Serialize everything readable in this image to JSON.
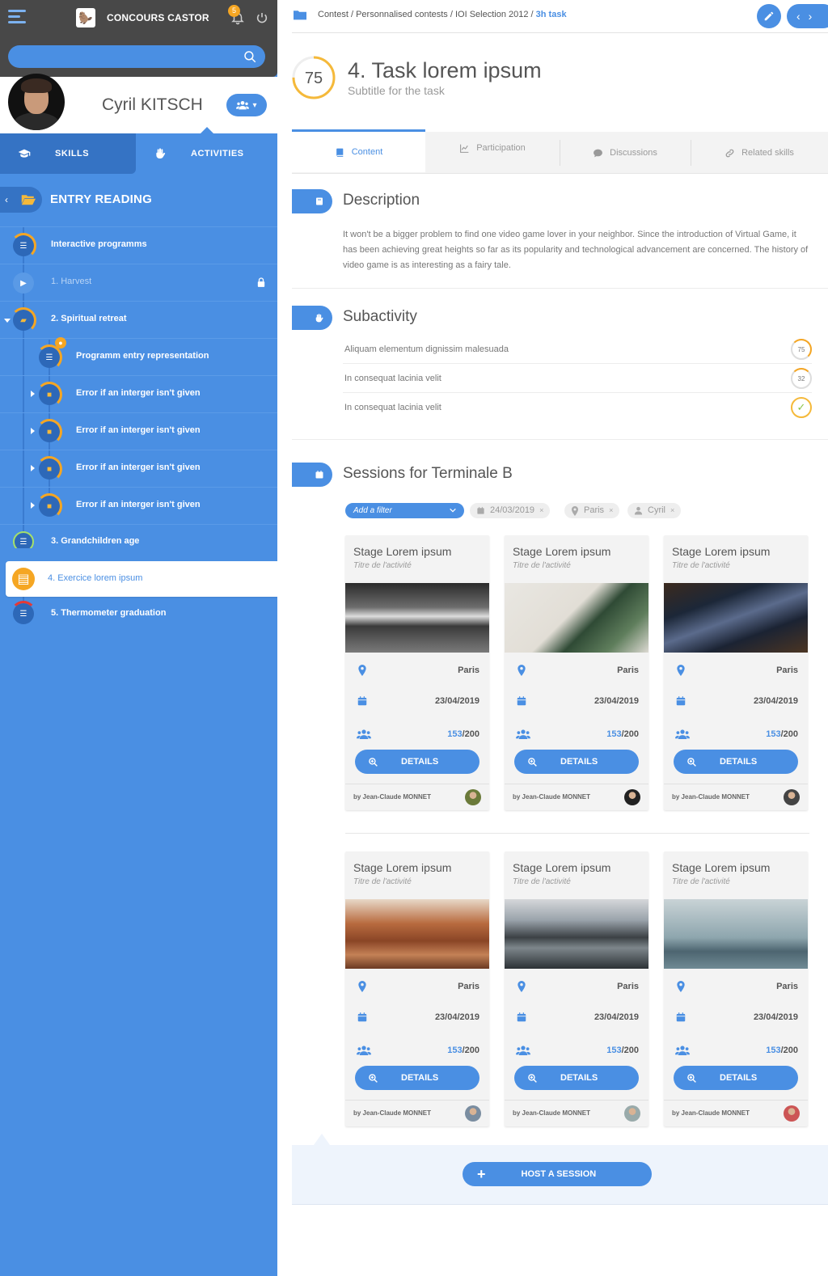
{
  "app": {
    "brand": "CONCOURS CASTOR",
    "notifications": "5",
    "search_placeholder": ""
  },
  "user": {
    "name": "Cyril KITSCH"
  },
  "side_tabs": [
    {
      "label": "SKILLS"
    },
    {
      "label": "ACTIVITIES"
    }
  ],
  "entry": {
    "title": "ENTRY READING"
  },
  "tree": [
    {
      "label": "Interactive programms"
    },
    {
      "label": "1. Harvest"
    },
    {
      "label": "2. Spiritual retreat"
    },
    {
      "label": "Programm entry representation"
    },
    {
      "label": "Error if an interger isn't given"
    },
    {
      "label": "Error if an interger isn't given"
    },
    {
      "label": "Error if an interger isn't given"
    },
    {
      "label": "Error if an interger isn't given"
    },
    {
      "label": "3. Grandchildren age"
    },
    {
      "label": "4. Exercice lorem ipsum"
    },
    {
      "label": "5. Thermometer graduation"
    }
  ],
  "breadcrumb": {
    "path": "Contest / Personnalised contests / IOI Selection 2012 / ",
    "current": "3h task"
  },
  "task": {
    "score": "75",
    "title": "4. Task lorem ipsum",
    "subtitle": "Subtitle for the task"
  },
  "tabs": [
    {
      "label": "Content"
    },
    {
      "label": "Participation"
    },
    {
      "label": "Discussions"
    },
    {
      "label": "Related skills"
    }
  ],
  "description": {
    "title": "Description",
    "text": "It won't be a bigger problem to find one video game lover in your neighbor. Since the introduction of Virtual Game, it has been achieving great heights so far as its popularity and technological advancement are concerned. The history of video game is as interesting as a fairy tale."
  },
  "subactivity": {
    "title": "Subactivity",
    "items": [
      {
        "label": "Aliquam elementum dignissim malesuada",
        "score": "75"
      },
      {
        "label": "In consequat lacinia velit",
        "score": "32"
      },
      {
        "label": "In consequat lacinia velit",
        "score": ""
      }
    ]
  },
  "sessions": {
    "title": "Sessions for Terminale B",
    "filter_placeholder": "Add a filter",
    "chips": [
      "24/03/2019",
      "Paris",
      "Cyril"
    ],
    "cards": [
      {
        "title": "Stage Lorem ipsum",
        "subtitle": "Titre de l'activité",
        "place": "Paris",
        "date": "23/04/2019",
        "count": "153",
        "total": "/200",
        "button": "DETAILS",
        "author": "by Jean-Claude MONNET"
      },
      {
        "title": "Stage Lorem ipsum",
        "subtitle": "Titre de l'activité",
        "place": "Paris",
        "date": "23/04/2019",
        "count": "153",
        "total": "/200",
        "button": "DETAILS",
        "author": "by Jean-Claude MONNET"
      },
      {
        "title": "Stage Lorem ipsum",
        "subtitle": "Titre de l'activité",
        "place": "Paris",
        "date": "23/04/2019",
        "count": "153",
        "total": "/200",
        "button": "DETAILS",
        "author": "by Jean-Claude MONNET"
      },
      {
        "title": "Stage Lorem ipsum",
        "subtitle": "Titre de l'activité",
        "place": "Paris",
        "date": "23/04/2019",
        "count": "153",
        "total": "/200",
        "button": "DETAILS",
        "author": "by Jean-Claude MONNET"
      },
      {
        "title": "Stage Lorem ipsum",
        "subtitle": "Titre de l'activité",
        "place": "Paris",
        "date": "23/04/2019",
        "count": "153",
        "total": "/200",
        "button": "DETAILS",
        "author": "by Jean-Claude MONNET"
      },
      {
        "title": "Stage Lorem ipsum",
        "subtitle": "Titre de l'activité",
        "place": "Paris",
        "date": "23/04/2019",
        "count": "153",
        "total": "/200",
        "button": "DETAILS",
        "author": "by Jean-Claude MONNET"
      }
    ],
    "host_button": "HOST A SESSION"
  },
  "colors": {
    "primary": "#4a8fe3",
    "dark_primary": "#3573c4",
    "accent": "#f5a623",
    "topbar": "#484848"
  }
}
